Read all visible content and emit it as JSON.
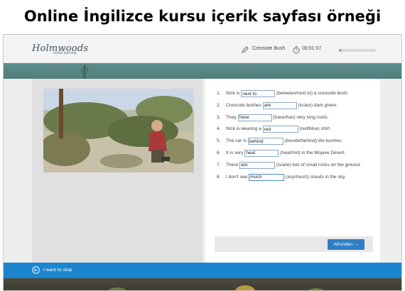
{
  "caption": "Online İngilizce kursu içerik sayfası örneği",
  "header": {
    "logo_text": "Holmwoods",
    "logo_subtext": "online learning",
    "lesson_name": "Creosote Bush",
    "timer": "00:01:07",
    "progress_fraction": 0.05,
    "icons": [
      "pencil-icon",
      "timer-icon"
    ]
  },
  "exercise": {
    "items": [
      {
        "num": "1.",
        "before": "Nick is ",
        "answer": "next to",
        "after": " (between/next to) a creosote bush."
      },
      {
        "num": "2.",
        "before": "Creosote bushes ",
        "answer": "are",
        "after": " (is/are) dark green."
      },
      {
        "num": "3.",
        "before": "They ",
        "answer": "have",
        "after": " (have/has) very long roots."
      },
      {
        "num": "4.",
        "before": "Nick is wearing a ",
        "answer": "red",
        "after": " (red/blue) shirt."
      },
      {
        "num": "5.",
        "before": "The car is ",
        "answer": "behind",
        "after": " (beside/behind) the bushes."
      },
      {
        "num": "6.",
        "before": "It is very ",
        "answer": "heat",
        "after": " (heat/hot) in the Mojave Desert."
      },
      {
        "num": "7.",
        "before": "There ",
        "answer": "are",
        "after": " (is/are) lots of small rocks on the ground."
      },
      {
        "num": "8.",
        "before": "I don't see ",
        "answer": "much",
        "after": " (any/much) clouds in the sky."
      }
    ],
    "next_label": "Afronden →"
  },
  "stopbar": {
    "label": "I want to stop",
    "icon": "exit-icon"
  },
  "colors": {
    "accent": "#2f7ec4",
    "stopbar": "#1b86cf",
    "banner": "#5e8e8c"
  }
}
